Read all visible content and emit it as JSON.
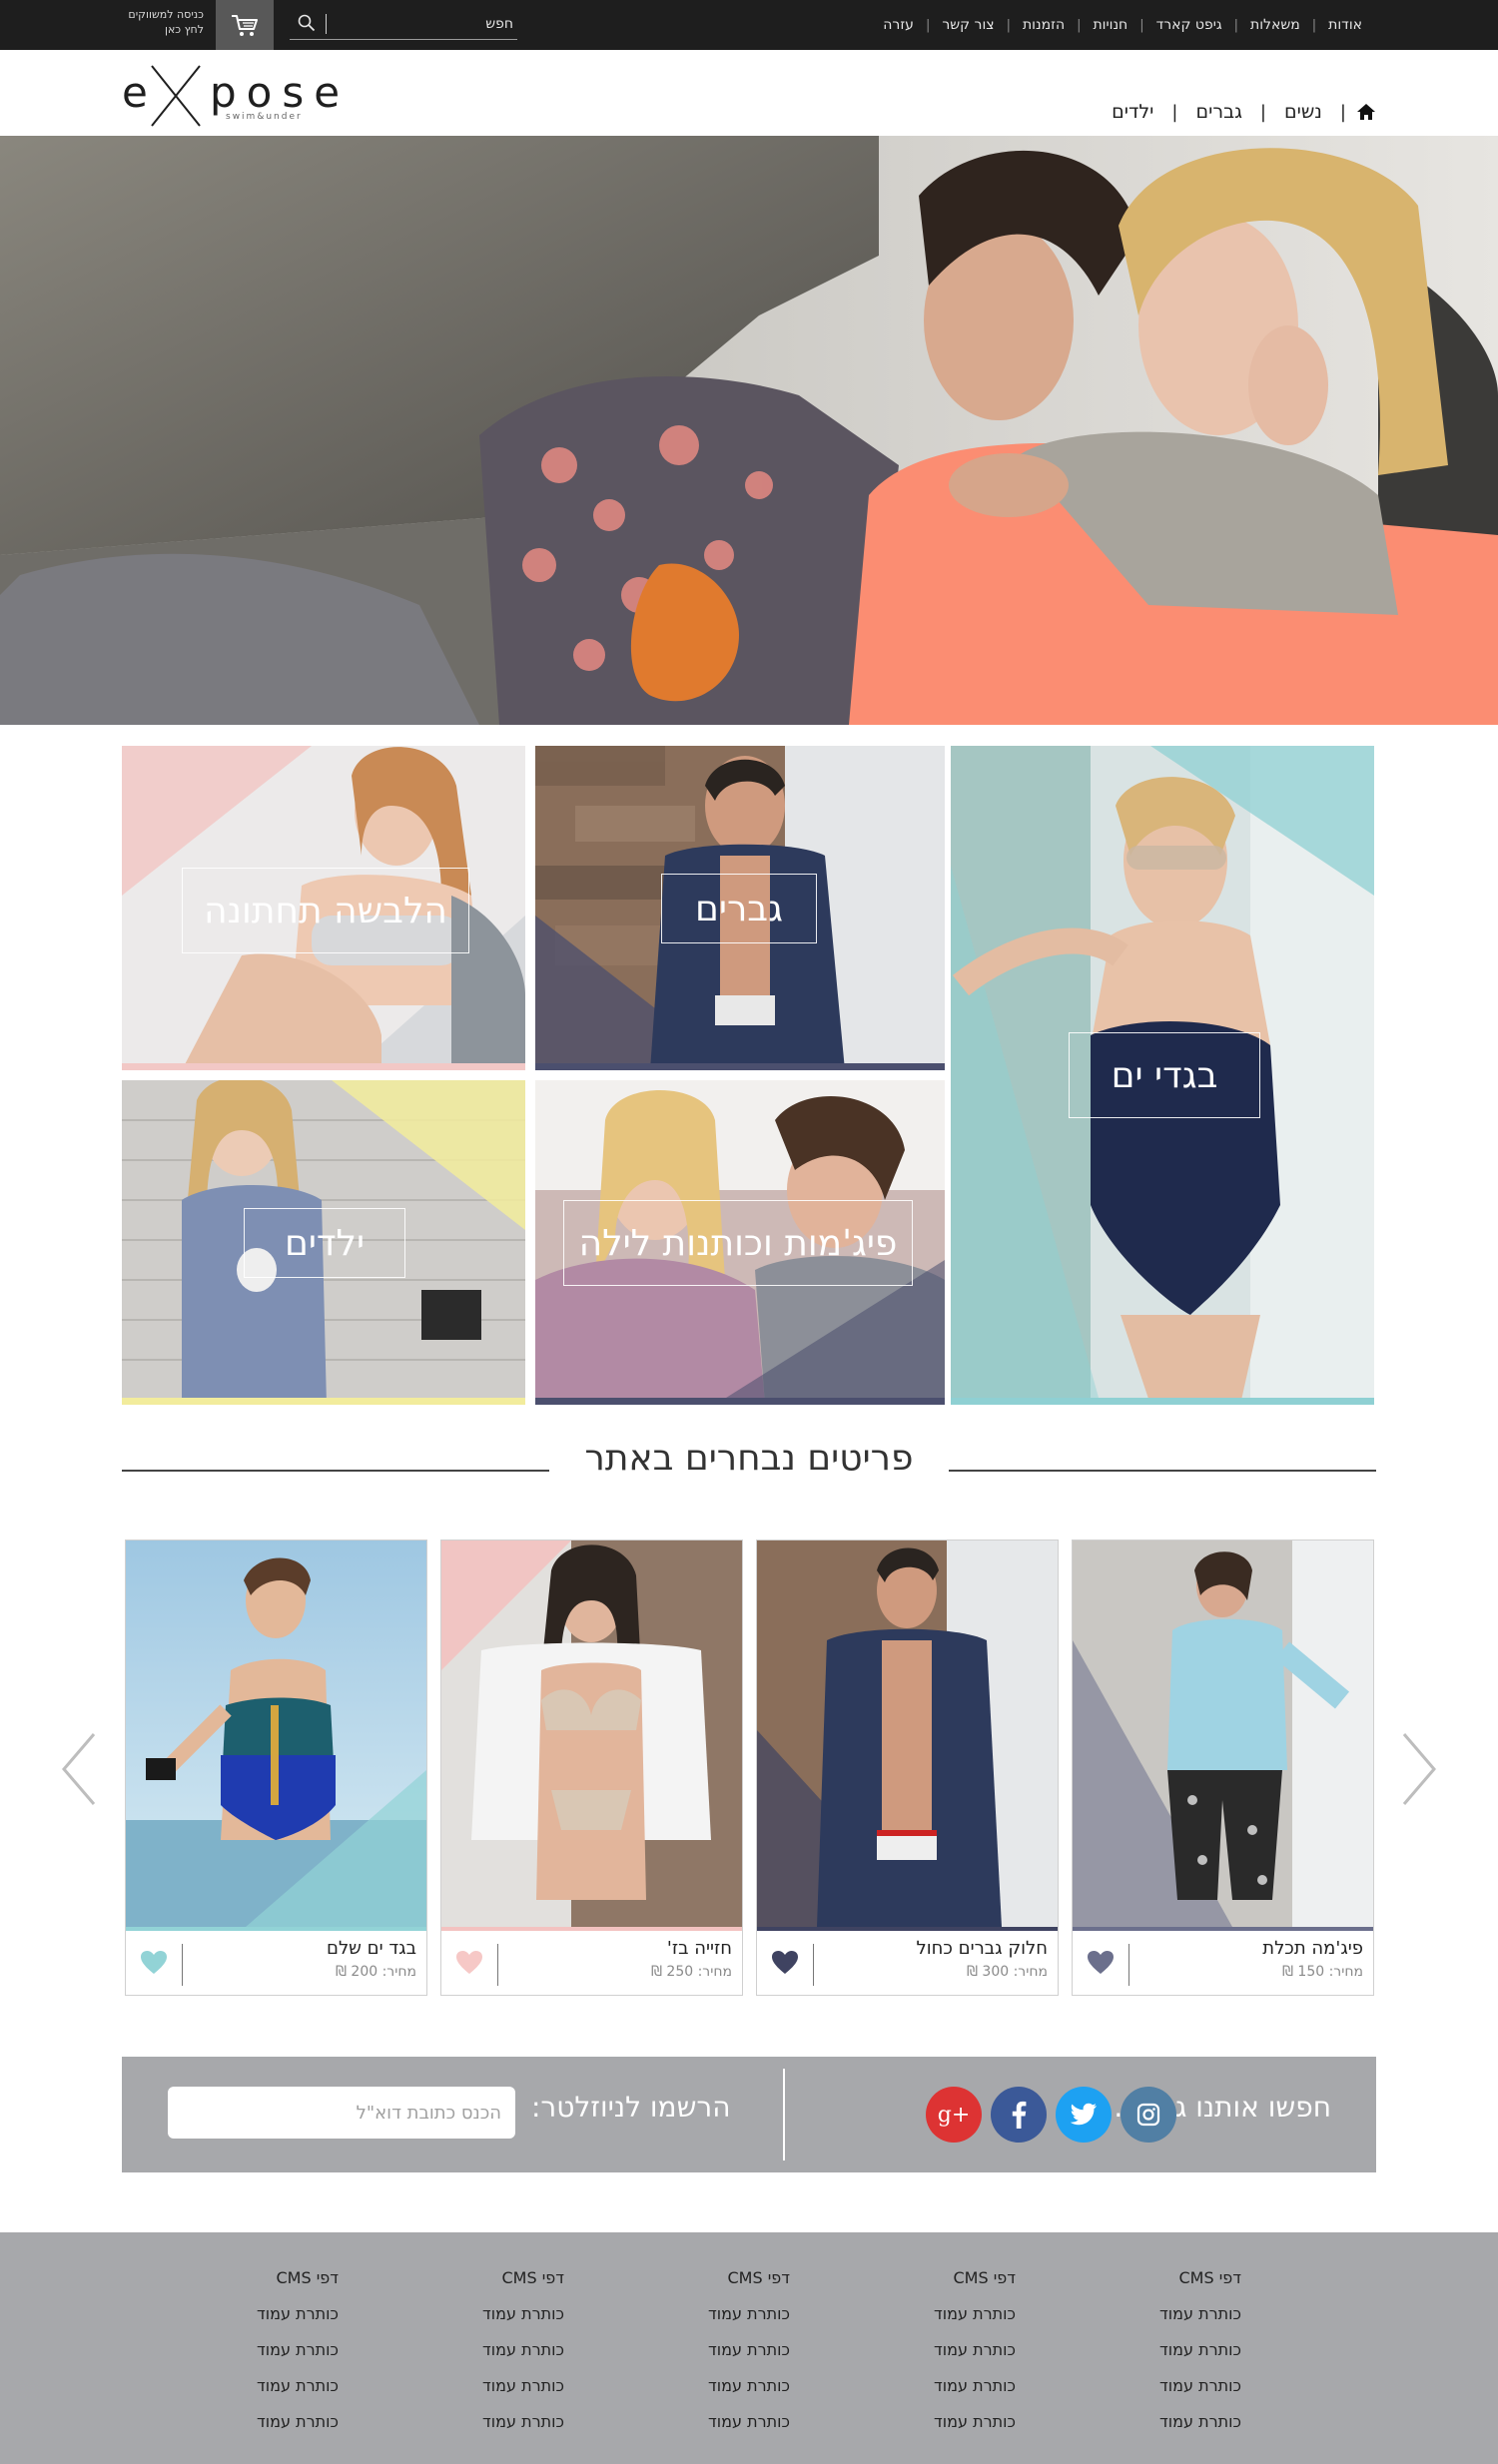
{
  "topbar": {
    "nav": [
      "אודות",
      "משאלות",
      "גיפט קארד",
      "חנויות",
      "הזמנות",
      "צור קשר",
      "עזרה"
    ],
    "search_placeholder": "חפש",
    "wholesale_line1": "כניסה למשווקים",
    "wholesale_line2": "לחץ כאן"
  },
  "header": {
    "logo": "expose",
    "logo_tagline": "swim&under",
    "nav": [
      "נשים",
      "גברים",
      "ילדים"
    ]
  },
  "categories": [
    {
      "label": "בגדי ים",
      "accent": "#8fd0d3"
    },
    {
      "label": "גברים",
      "accent": "#4b4f6e"
    },
    {
      "label": "הלבשה תחתונה",
      "accent": "#f2c8c6"
    },
    {
      "label": "פיג'מות וכותנות לילה",
      "accent": "#4b4f6e"
    },
    {
      "label": "ילדים",
      "accent": "#f2ec9c"
    }
  ],
  "featured": {
    "title": "פריטים נבחרים באתר",
    "products": [
      {
        "name": "פיג'מה תכלת",
        "price": "מחיר: 150 ₪",
        "accent": "#6b6f8c"
      },
      {
        "name": "חלוק גברים כחול",
        "price": "מחיר: 300 ₪",
        "accent": "#3f4361"
      },
      {
        "name": "חזייה בז'",
        "price": "מחיר: 250 ₪",
        "accent": "#f3c2c0"
      },
      {
        "name": "בגד ים שלם",
        "price": "מחיר: 200 ₪",
        "accent": "#92d3d6"
      }
    ]
  },
  "social": {
    "label": "חפשו אותנו גם ב...",
    "icons": [
      "instagram-icon",
      "twitter-icon",
      "facebook-icon",
      "google-plus-icon"
    ],
    "colors": [
      "#517fa4",
      "#1da1f2",
      "#3b5998",
      "#dd3333"
    ]
  },
  "newsletter": {
    "label": "הרשמו לניוזלטר:",
    "placeholder": "הכנס כתובת דוא\"ל"
  },
  "footer": {
    "columns": [
      {
        "title": "דפי CMS",
        "links": [
          "כותרת עמוד",
          "כותרת עמוד",
          "כותרת עמוד",
          "כותרת עמוד"
        ]
      },
      {
        "title": "דפי CMS",
        "links": [
          "כותרת עמוד",
          "כותרת עמוד",
          "כותרת עמוד",
          "כותרת עמוד"
        ]
      },
      {
        "title": "דפי CMS",
        "links": [
          "כותרת עמוד",
          "כותרת עמוד",
          "כותרת עמוד",
          "כותרת עמוד"
        ]
      },
      {
        "title": "דפי CMS",
        "links": [
          "כותרת עמוד",
          "כותרת עמוד",
          "כותרת עמוד",
          "כותרת עמוד"
        ]
      },
      {
        "title": "דפי CMS",
        "links": [
          "כותרת עמוד",
          "כותרת עמוד",
          "כותרת עמוד",
          "כותרת עמוד"
        ]
      }
    ]
  }
}
